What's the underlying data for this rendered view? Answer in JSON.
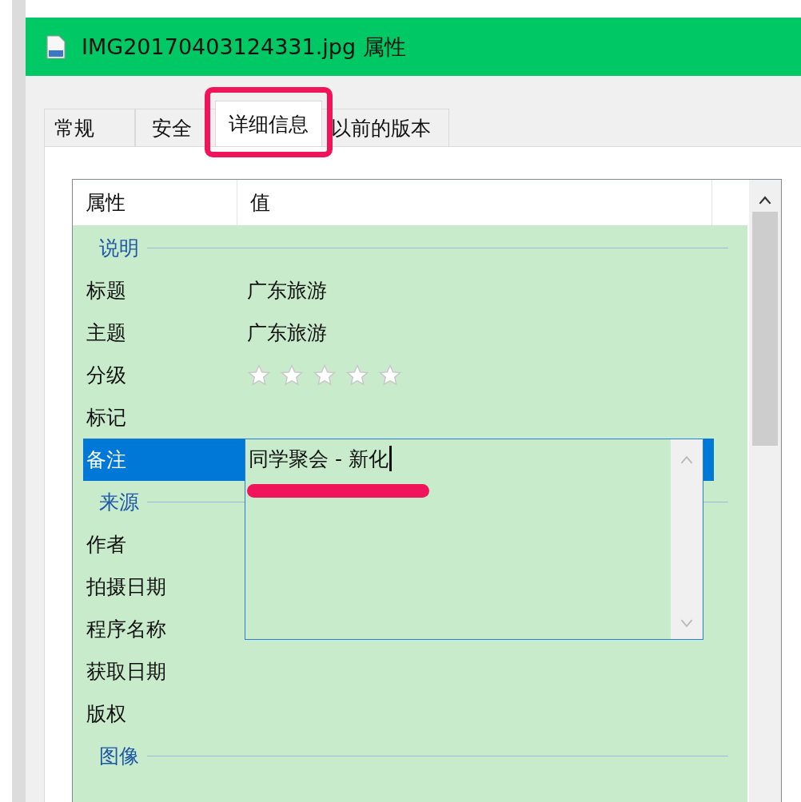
{
  "window": {
    "title": "IMG20170403124331.jpg 属性"
  },
  "tabs": [
    {
      "label": "常规",
      "selected": false
    },
    {
      "label": "安全",
      "selected": false
    },
    {
      "label": "详细信息",
      "selected": true
    },
    {
      "label": "以前的版本",
      "selected": false
    }
  ],
  "list": {
    "columns": [
      "属性",
      "值"
    ],
    "rows": [
      {
        "kind": "group",
        "label": "说明"
      },
      {
        "kind": "text",
        "name": "标题",
        "value": "广东旅游",
        "selected": false
      },
      {
        "kind": "text",
        "name": "主题",
        "value": "广东旅游",
        "selected": false
      },
      {
        "kind": "rating",
        "name": "分级",
        "stars": 0,
        "selected": false
      },
      {
        "kind": "text",
        "name": "标记",
        "selected": false
      },
      {
        "kind": "edit",
        "name": "备注",
        "value": "同学聚会 - 新化",
        "selected": true
      },
      {
        "kind": "group",
        "label": "来源"
      },
      {
        "kind": "text",
        "name": "作者",
        "selected": false
      },
      {
        "kind": "text",
        "name": "拍摄日期",
        "selected": false
      },
      {
        "kind": "text",
        "name": "程序名称",
        "selected": false
      },
      {
        "kind": "text",
        "name": "获取日期",
        "selected": false
      },
      {
        "kind": "text",
        "name": "版权",
        "selected": false
      },
      {
        "kind": "group",
        "label": "图像"
      }
    ]
  }
}
